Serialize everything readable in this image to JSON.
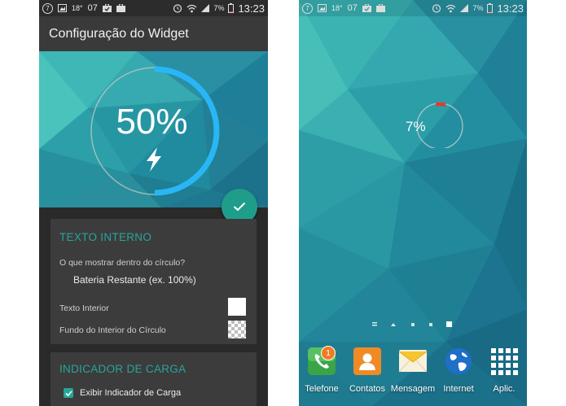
{
  "left_screen": {
    "statusbar": {
      "notif_count": "7",
      "temperature": "18°",
      "date_num": "07",
      "battery_pct": "7%",
      "time": "13:23"
    },
    "appbar_title": "Configuração do Widget",
    "preview": {
      "battery_text": "50%",
      "charge_level": 0.5
    },
    "inner_text_card": {
      "title": "TEXTO INTERNO",
      "question": "O que mostrar dentro do círculo?",
      "selected_value": "Bateria Restante (ex. 100%)",
      "inner_text_label": "Texto Interior",
      "inner_bg_label": "Fundo do Interior do Círculo"
    },
    "charge_card": {
      "title": "INDICADOR DE CARGA",
      "checkbox_label": "Exibir Indicador de Carga",
      "checked": true
    },
    "colors": {
      "accent": "#26a69a",
      "ring": "#29b6f6"
    }
  },
  "right_screen": {
    "statusbar": {
      "notif_count": "7",
      "temperature": "18°",
      "date_num": "07",
      "battery_pct": "7%",
      "time": "13:23"
    },
    "widget": {
      "battery_text": "7%",
      "charge_level": 0.07,
      "color": "#e53935"
    },
    "dock": [
      {
        "label": "Telefone",
        "badge": "1",
        "icon": "phone-icon"
      },
      {
        "label": "Contatos",
        "icon": "contacts-icon"
      },
      {
        "label": "Mensagem",
        "icon": "message-icon"
      },
      {
        "label": "Internet",
        "icon": "globe-icon"
      },
      {
        "label": "Aplic.",
        "icon": "apps-grid-icon"
      }
    ]
  }
}
